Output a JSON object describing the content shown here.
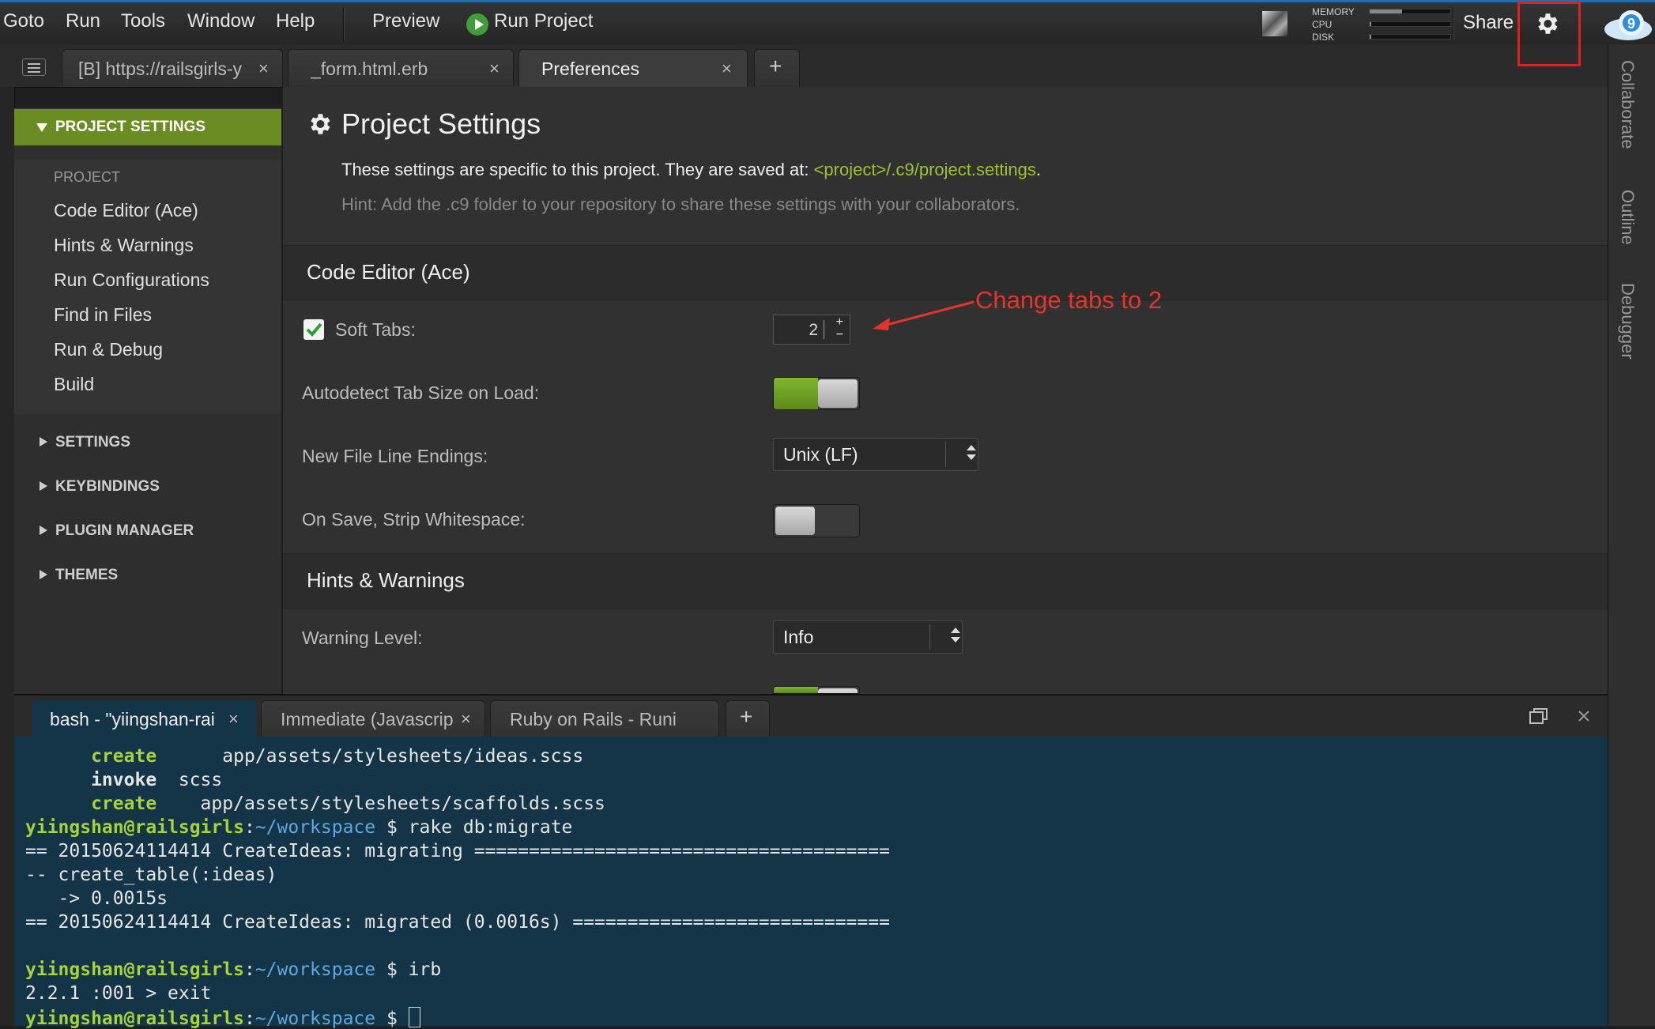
{
  "menu": {
    "items": [
      "Goto",
      "Run",
      "Tools",
      "Window",
      "Help"
    ],
    "preview": "Preview",
    "run_project": "Run Project",
    "meters": {
      "memory_label": "MEMORY",
      "cpu_label": "CPU",
      "disk_label": "DISK",
      "memory_level": 0.4,
      "cpu_level": 0.02,
      "disk_level": 0.02
    },
    "share": "Share"
  },
  "tabs": [
    {
      "label": "[B] https://railsgirls-y",
      "close": "×"
    },
    {
      "label": "_form.html.erb",
      "close": "×"
    },
    {
      "label": "Preferences",
      "close": "×"
    }
  ],
  "tab_add": "+",
  "right_panel": [
    "Collaborate",
    "Outline",
    "Debugger"
  ],
  "nav": {
    "project_settings": "PROJECT SETTINGS",
    "project_label": "PROJECT",
    "project_items": [
      "Code Editor (Ace)",
      "Hints & Warnings",
      "Run Configurations",
      "Find in Files",
      "Run & Debug",
      "Build"
    ],
    "groups": [
      "SETTINGS",
      "KEYBINDINGS",
      "PLUGIN MANAGER",
      "THEMES"
    ]
  },
  "content": {
    "title": "Project Settings",
    "desc_prefix": "These settings are specific to this project. They are saved at: ",
    "desc_path": "<project>/.c9/project.settings",
    "desc_suffix": ".",
    "hint": "Hint: Add the .c9 folder to your repository to share these settings with your collaborators.",
    "sections": {
      "code_editor": "Code Editor (Ace)",
      "hints": "Hints & Warnings"
    },
    "soft_tabs": {
      "label": "Soft Tabs:",
      "checked": true,
      "value": "2",
      "step_up": "+",
      "step_down": "−"
    },
    "autodetect": {
      "label": "Autodetect Tab Size on Load:",
      "on": true
    },
    "line_endings": {
      "label": "New File Line Endings:",
      "value": "Unix (LF)"
    },
    "strip_ws": {
      "label": "On Save, Strip Whitespace:",
      "on": false
    },
    "warning_level": {
      "label": "Warning Level:",
      "value": "Info"
    },
    "annotation": "Change tabs to 2",
    "colors": {
      "accent": "#6a8c22",
      "annotation": "#e8332b",
      "path": "#9bc23a"
    }
  },
  "bottom_tabs": [
    {
      "label": "bash - \"yiingshan-rai",
      "close": "×"
    },
    {
      "label": "Immediate (Javascrip",
      "close": "×"
    },
    {
      "label": "Ruby on Rails - Runi"
    }
  ],
  "bottom_add": "+",
  "terminal": {
    "l1_kw": "      create",
    "l1_rest": "      app/assets/stylesheets/ideas.scss",
    "l2_kw": "      invoke",
    "l2_rest": "  scss",
    "l3_kw": "      create",
    "l3_rest": "    app/assets/stylesheets/scaffolds.scss",
    "prompt_user": "yiingshan@railsgirls",
    "prompt_colon": ":",
    "prompt_path": "~/workspace",
    "cmd1": " $ rake db:migrate",
    "l5": "== 20150624114414 CreateIdeas: migrating ======================================",
    "l6": "-- create_table(:ideas)",
    "l7": "   -> 0.0015s",
    "l8": "== 20150624114414 CreateIdeas: migrated (0.0016s) =============================",
    "cmd2": " $ irb",
    "l10": "2.2.1 :001 > exit",
    "cmd3": " $ "
  }
}
